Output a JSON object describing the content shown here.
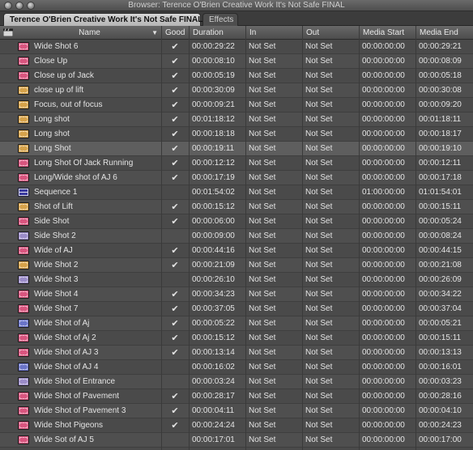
{
  "window": {
    "title": "Browser: Terence O'Brien Creative Work It's Not Safe FINAL"
  },
  "tabs": [
    {
      "label": "Terence O'Brien Creative Work It's Not Safe FINAL",
      "active": true
    },
    {
      "label": "Effects",
      "active": false
    }
  ],
  "columns": {
    "name": "Name",
    "good": "Good",
    "duration": "Duration",
    "in": "In",
    "out": "Out",
    "media_start": "Media Start",
    "media_end": "Media End"
  },
  "clip_colors": {
    "pink": "#d9557f",
    "orange": "#d6a24a",
    "lavender": "#9b8cc8",
    "blue": "#6a74c8"
  },
  "check_glyph": "✔",
  "rows": [
    {
      "name": " Wide Shot 6",
      "icon": "pink",
      "good": true,
      "duration": "00:00:29:22",
      "in": "Not Set",
      "out": "Not Set",
      "media_start": "00:00:00:00",
      "media_end": "00:00:29:21"
    },
    {
      "name": "Close Up",
      "icon": "pink",
      "good": true,
      "duration": "00:00:08:10",
      "in": "Not Set",
      "out": "Not Set",
      "media_start": "00:00:00:00",
      "media_end": "00:00:08:09"
    },
    {
      "name": "Close up of Jack",
      "icon": "pink",
      "good": true,
      "duration": "00:00:05:19",
      "in": "Not Set",
      "out": "Not Set",
      "media_start": "00:00:00:00",
      "media_end": "00:00:05:18"
    },
    {
      "name": "close up of lift",
      "icon": "orange",
      "good": true,
      "duration": "00:00:30:09",
      "in": "Not Set",
      "out": "Not Set",
      "media_start": "00:00:00:00",
      "media_end": "00:00:30:08"
    },
    {
      "name": "Focus, out of focus",
      "icon": "orange",
      "good": true,
      "duration": "00:00:09:21",
      "in": "Not Set",
      "out": "Not Set",
      "media_start": "00:00:00:00",
      "media_end": "00:00:09:20"
    },
    {
      "name": "Long shot",
      "icon": "orange",
      "good": true,
      "duration": "00:01:18:12",
      "in": "Not Set",
      "out": "Not Set",
      "media_start": "00:00:00:00",
      "media_end": "00:01:18:11"
    },
    {
      "name": "Long shot",
      "icon": "orange",
      "good": true,
      "duration": "00:00:18:18",
      "in": "Not Set",
      "out": "Not Set",
      "media_start": "00:00:00:00",
      "media_end": "00:00:18:17"
    },
    {
      "name": "Long Shot",
      "icon": "orange",
      "good": true,
      "duration": "00:00:19:11",
      "in": "Not Set",
      "out": "Not Set",
      "media_start": "00:00:00:00",
      "media_end": "00:00:19:10",
      "selected": true
    },
    {
      "name": "Long Shot Of Jack Running",
      "icon": "pink",
      "good": true,
      "duration": "00:00:12:12",
      "in": "Not Set",
      "out": "Not Set",
      "media_start": "00:00:00:00",
      "media_end": "00:00:12:11"
    },
    {
      "name": "Long/Wide shot of AJ 6",
      "icon": "pink",
      "good": true,
      "duration": "00:00:17:19",
      "in": "Not Set",
      "out": "Not Set",
      "media_start": "00:00:00:00",
      "media_end": "00:00:17:18"
    },
    {
      "name": "Sequence 1",
      "icon": "sequence",
      "good": false,
      "duration": "00:01:54:02",
      "in": "Not Set",
      "out": "Not Set",
      "media_start": "01:00:00:00",
      "media_end": "01:01:54:01"
    },
    {
      "name": "Shot of Lift",
      "icon": "orange",
      "good": true,
      "duration": "00:00:15:12",
      "in": "Not Set",
      "out": "Not Set",
      "media_start": "00:00:00:00",
      "media_end": "00:00:15:11"
    },
    {
      "name": "Side Shot",
      "icon": "pink",
      "good": true,
      "duration": "00:00:06:00",
      "in": "Not Set",
      "out": "Not Set",
      "media_start": "00:00:00:00",
      "media_end": "00:00:05:24"
    },
    {
      "name": "Side Shot 2",
      "icon": "lavender",
      "good": false,
      "duration": "00:00:09:00",
      "in": "Not Set",
      "out": "Not Set",
      "media_start": "00:00:00:00",
      "media_end": "00:00:08:24"
    },
    {
      "name": "Wide of AJ",
      "icon": "pink",
      "good": true,
      "duration": "00:00:44:16",
      "in": "Not Set",
      "out": "Not Set",
      "media_start": "00:00:00:00",
      "media_end": "00:00:44:15"
    },
    {
      "name": "Wide Shot 2",
      "icon": "orange",
      "good": true,
      "duration": "00:00:21:09",
      "in": "Not Set",
      "out": "Not Set",
      "media_start": "00:00:00:00",
      "media_end": "00:00:21:08"
    },
    {
      "name": "Wide Shot 3",
      "icon": "lavender",
      "good": false,
      "duration": "00:00:26:10",
      "in": "Not Set",
      "out": "Not Set",
      "media_start": "00:00:00:00",
      "media_end": "00:00:26:09"
    },
    {
      "name": "Wide Shot 4",
      "icon": "pink",
      "good": true,
      "duration": "00:00:34:23",
      "in": "Not Set",
      "out": "Not Set",
      "media_start": "00:00:00:00",
      "media_end": "00:00:34:22"
    },
    {
      "name": "Wide Shot 7",
      "icon": "pink",
      "good": true,
      "duration": "00:00:37:05",
      "in": "Not Set",
      "out": "Not Set",
      "media_start": "00:00:00:00",
      "media_end": "00:00:37:04"
    },
    {
      "name": "Wide Shot of Aj",
      "icon": "blue",
      "good": true,
      "duration": "00:00:05:22",
      "in": "Not Set",
      "out": "Not Set",
      "media_start": "00:00:00:00",
      "media_end": "00:00:05:21"
    },
    {
      "name": "Wide Shot of Aj 2",
      "icon": "pink",
      "good": true,
      "duration": "00:00:15:12",
      "in": "Not Set",
      "out": "Not Set",
      "media_start": "00:00:00:00",
      "media_end": "00:00:15:11"
    },
    {
      "name": "Wide Shot of AJ 3",
      "icon": "pink",
      "good": true,
      "duration": "00:00:13:14",
      "in": "Not Set",
      "out": "Not Set",
      "media_start": "00:00:00:00",
      "media_end": "00:00:13:13"
    },
    {
      "name": "Wide Shot of AJ 4",
      "icon": "blue",
      "good": false,
      "duration": "00:00:16:02",
      "in": "Not Set",
      "out": "Not Set",
      "media_start": "00:00:00:00",
      "media_end": "00:00:16:01"
    },
    {
      "name": "Wide Shot of Entrance",
      "icon": "lavender",
      "good": false,
      "duration": "00:00:03:24",
      "in": "Not Set",
      "out": "Not Set",
      "media_start": "00:00:00:00",
      "media_end": "00:00:03:23"
    },
    {
      "name": "Wide Shot of Pavement",
      "icon": "pink",
      "good": true,
      "duration": "00:00:28:17",
      "in": "Not Set",
      "out": "Not Set",
      "media_start": "00:00:00:00",
      "media_end": "00:00:28:16"
    },
    {
      "name": "Wide Shot of Pavement 3",
      "icon": "pink",
      "good": true,
      "duration": "00:00:04:11",
      "in": "Not Set",
      "out": "Not Set",
      "media_start": "00:00:00:00",
      "media_end": "00:00:04:10"
    },
    {
      "name": "Wide Shot Pigeons",
      "icon": "pink",
      "good": true,
      "duration": "00:00:24:24",
      "in": "Not Set",
      "out": "Not Set",
      "media_start": "00:00:00:00",
      "media_end": "00:00:24:23"
    },
    {
      "name": "Wide Sot of AJ 5",
      "icon": "pink",
      "good": false,
      "duration": "00:00:17:01",
      "in": "Not Set",
      "out": "Not Set",
      "media_start": "00:00:00:00",
      "media_end": "00:00:17:00"
    }
  ]
}
